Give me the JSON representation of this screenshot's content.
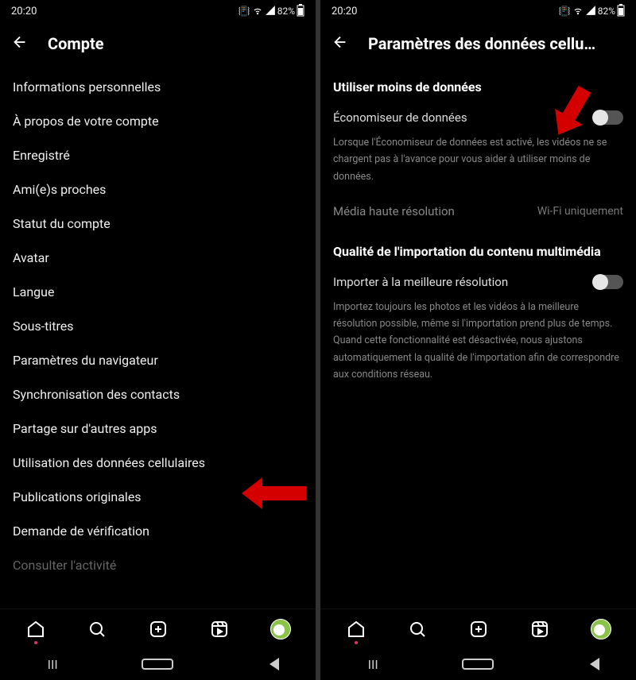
{
  "status": {
    "time": "20:20",
    "battery": "82%"
  },
  "left": {
    "title": "Compte",
    "items": [
      "Informations personnelles",
      "À propos de votre compte",
      "Enregistré",
      "Ami(e)s proches",
      "Statut du compte",
      "Avatar",
      "Langue",
      "Sous-titres",
      "Paramètres du navigateur",
      "Synchronisation des contacts",
      "Partage sur d'autres apps",
      "Utilisation des données cellulaires",
      "Publications originales",
      "Demande de vérification",
      "Consulter l'activité"
    ]
  },
  "right": {
    "title": "Paramètres des données cellu…",
    "section1": "Utiliser moins de données",
    "dataSaverLabel": "Économiseur de données",
    "dataSaverDesc": "Lorsque l'Économiseur de données est activé, les vidéos ne se chargent pas à l'avance pour vous aider à utiliser moins de données.",
    "highResLabel": "Média haute résolution",
    "highResValue": "Wi-Fi uniquement",
    "section2": "Qualité de l'importation du contenu multimédia",
    "bestResLabel": "Importer à la meilleure résolution",
    "bestResDesc": "Importez toujours les photos et les vidéos à la meilleure résolution possible, même si l'importation prend plus de temps. Quand cette fonctionnalité est désactivée, nous ajustons automatiquement la qualité de l'importation afin de correspondre aux conditions réseau."
  }
}
